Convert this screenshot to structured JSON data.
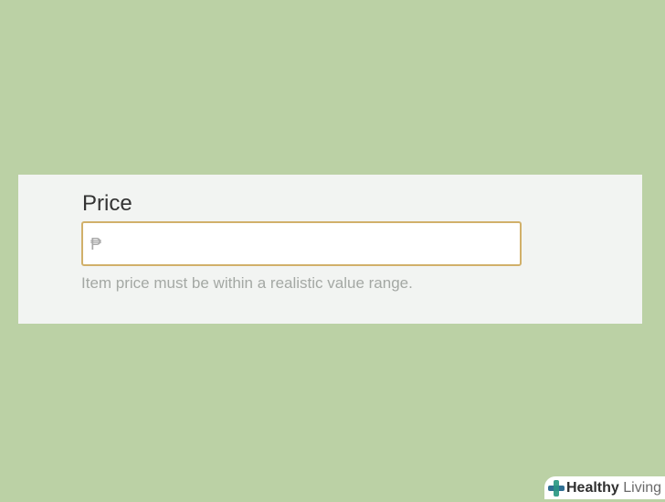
{
  "form": {
    "price": {
      "label": "Price",
      "currency_symbol": "₱",
      "value": "",
      "placeholder": "",
      "help_text": "Item price must be within a realistic value range."
    }
  },
  "colors": {
    "background": "#bbd1a5",
    "panel": "#f2f4f2",
    "input_border": "#d1b06a",
    "help_text": "#a4a8a4"
  },
  "watermark": {
    "brand_bold": "Healthy",
    "brand_light": " Living",
    "icon": "plus-cross-icon"
  }
}
